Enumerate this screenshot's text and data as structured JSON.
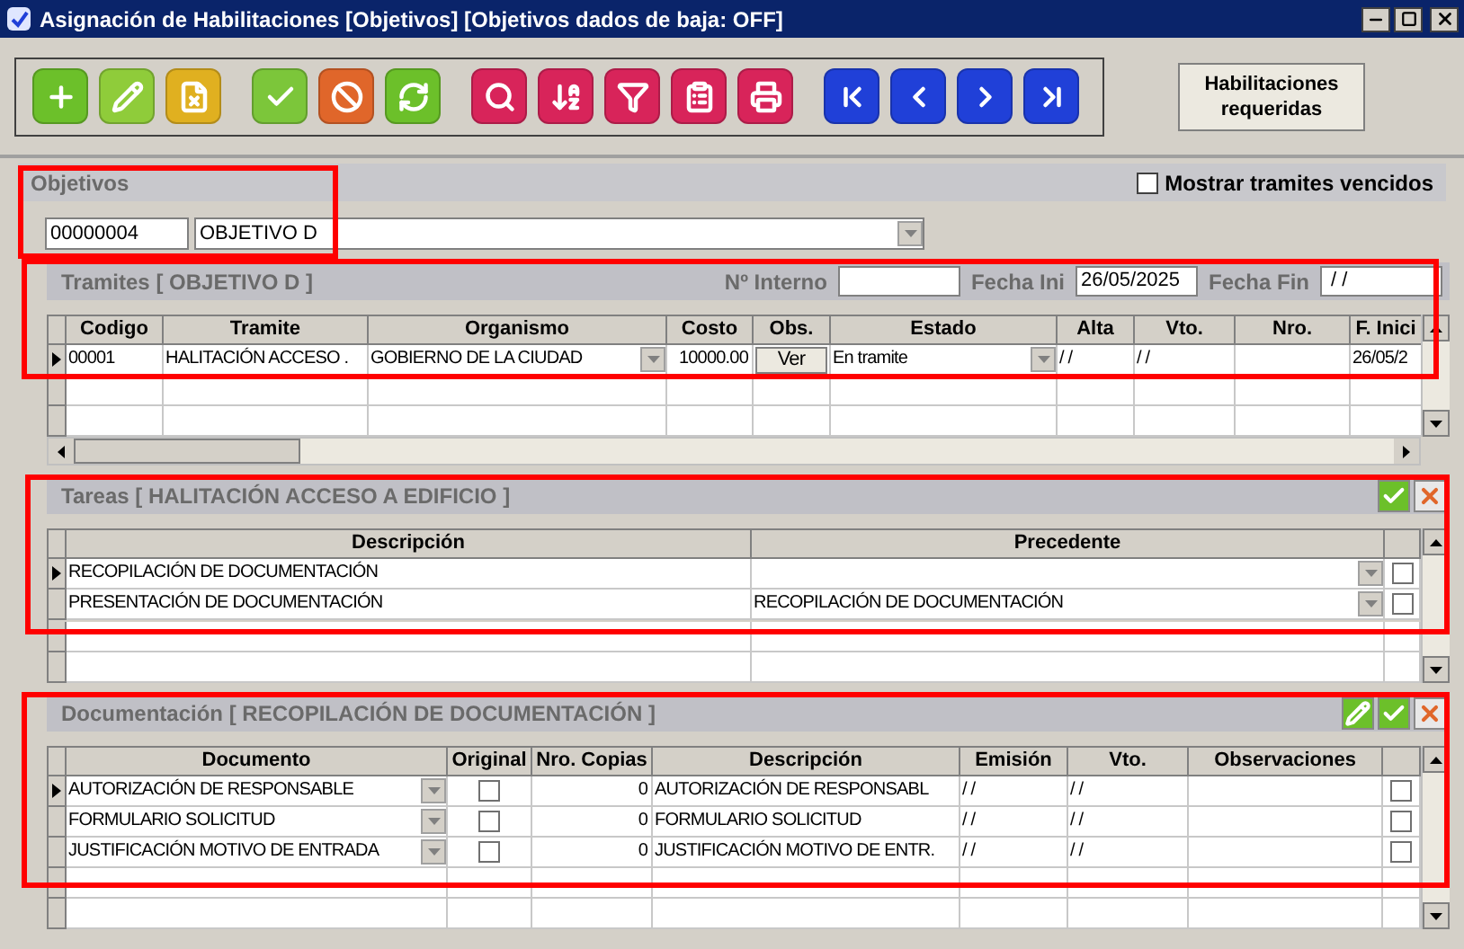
{
  "window": {
    "title": "Asignación de Habilitaciones [Objetivos] [Objetivos dados de baja: OFF]"
  },
  "toolbar": [
    [
      {
        "kind": "add",
        "color": "#6cc02a"
      },
      {
        "kind": "edit",
        "color": "#8fcc3a"
      },
      {
        "kind": "delete",
        "color": "#e0b020"
      }
    ],
    [
      {
        "kind": "confirm",
        "color": "#7cc63a"
      },
      {
        "kind": "cancel",
        "color": "#e0662a"
      },
      {
        "kind": "refresh",
        "color": "#6cc02a"
      }
    ],
    [
      {
        "kind": "search",
        "color": "#d8245a"
      },
      {
        "kind": "sort",
        "color": "#d8245a"
      },
      {
        "kind": "filter",
        "color": "#d8245a"
      },
      {
        "kind": "report",
        "color": "#d8245a"
      },
      {
        "kind": "print",
        "color": "#d8245a"
      }
    ],
    [
      {
        "kind": "first",
        "color": "#2040d8"
      },
      {
        "kind": "prev",
        "color": "#2040d8"
      },
      {
        "kind": "next",
        "color": "#2040d8"
      },
      {
        "kind": "last",
        "color": "#2040d8"
      }
    ]
  ],
  "side_button": {
    "label": "Habilitaciones requeridas"
  },
  "objetivos": {
    "title": "Objetivos",
    "code": "00000004",
    "name": "OBJETIVO D",
    "show_expired": {
      "label": "Mostrar tramites vencidos",
      "checked": false
    }
  },
  "tramites": {
    "title": "Tramites [ OBJETIVO D ]",
    "fields": [
      {
        "label": "Nº Interno"
      },
      {
        "label": "Fecha Ini",
        "value": "26/05/2025"
      },
      {
        "label": "Fecha Fin",
        "value": " / /"
      }
    ],
    "columns": [
      "Codigo",
      "Tramite",
      "Organismo",
      "Costo",
      "Obs.",
      "Estado",
      "Alta",
      "Vto.",
      "Nro.",
      "F. Inici"
    ],
    "rows": [
      {
        "selected": true,
        "cells": [
          {
            "kind": "text",
            "text": "00001"
          },
          {
            "kind": "text",
            "text": "HALITACIÓN ACCESO ."
          },
          {
            "kind": "dropdown",
            "text": "GOBIERNO DE LA CIUDAD"
          },
          {
            "kind": "number",
            "text": "10000.00"
          },
          {
            "kind": "button",
            "text": "Ver"
          },
          {
            "kind": "dropdown",
            "text": "En tramite"
          },
          {
            "kind": "text",
            "text": " / /"
          },
          {
            "kind": "text",
            "text": " / /"
          },
          {
            "kind": "text"
          },
          {
            "kind": "text",
            "text": "26/05/2"
          }
        ]
      }
    ]
  },
  "tareas": {
    "title": "Tareas [ HALITACIÓN ACCESO A EDIFICIO ]",
    "actions": [
      {
        "kind": "confirm"
      },
      {
        "kind": "cancel"
      }
    ],
    "columns": [
      "Descripción",
      "Precedente"
    ],
    "rows": [
      {
        "selected": true,
        "cells": [
          {
            "kind": "text",
            "text": "RECOPILACIÓN DE DOCUMENTACIÓN"
          },
          {
            "kind": "dropdown"
          },
          {
            "kind": "checkbox",
            "checked": false
          }
        ]
      },
      {
        "selected": false,
        "cells": [
          {
            "kind": "text",
            "text": "PRESENTACIÓN DE DOCUMENTACIÓN"
          },
          {
            "kind": "dropdown",
            "text": "RECOPILACIÓN DE DOCUMENTACIÓN"
          },
          {
            "kind": "checkbox",
            "checked": false
          }
        ]
      }
    ]
  },
  "documentacion": {
    "title": "Documentación [ RECOPILACIÓN DE DOCUMENTACIÓN ]",
    "actions": [
      {
        "kind": "edit"
      },
      {
        "kind": "confirm"
      },
      {
        "kind": "cancel"
      }
    ],
    "columns": [
      "Documento",
      "Original",
      "Nro. Copias",
      "Descripción",
      "Emisión",
      "Vto.",
      "Observaciones"
    ],
    "rows": [
      {
        "selected": true,
        "cells": [
          {
            "kind": "dropdown",
            "text": "AUTORIZACIÓN DE RESPONSABLE"
          },
          {
            "kind": "checkbox",
            "checked": false
          },
          {
            "kind": "number",
            "text": "0"
          },
          {
            "kind": "text",
            "text": "AUTORIZACIÓN DE RESPONSABL"
          },
          {
            "kind": "text",
            "text": " / /"
          },
          {
            "kind": "text",
            "text": " / /"
          },
          {
            "kind": "text"
          },
          {
            "kind": "checkbox",
            "checked": false
          }
        ]
      },
      {
        "selected": false,
        "cells": [
          {
            "kind": "dropdown",
            "text": "FORMULARIO SOLICITUD"
          },
          {
            "kind": "checkbox",
            "checked": false
          },
          {
            "kind": "number",
            "text": "0"
          },
          {
            "kind": "text",
            "text": "FORMULARIO SOLICITUD"
          },
          {
            "kind": "text",
            "text": " / /"
          },
          {
            "kind": "text",
            "text": " / /"
          },
          {
            "kind": "text"
          },
          {
            "kind": "checkbox",
            "checked": false
          }
        ]
      },
      {
        "selected": false,
        "cells": [
          {
            "kind": "dropdown",
            "text": "JUSTIFICACIÓN MOTIVO DE ENTRADA"
          },
          {
            "kind": "checkbox",
            "checked": false
          },
          {
            "kind": "number",
            "text": "0"
          },
          {
            "kind": "text",
            "text": "JUSTIFICACIÓN MOTIVO DE ENTR."
          },
          {
            "kind": "text",
            "text": " / /"
          },
          {
            "kind": "text",
            "text": " / /"
          },
          {
            "kind": "text"
          },
          {
            "kind": "checkbox",
            "checked": false
          }
        ]
      }
    ]
  }
}
